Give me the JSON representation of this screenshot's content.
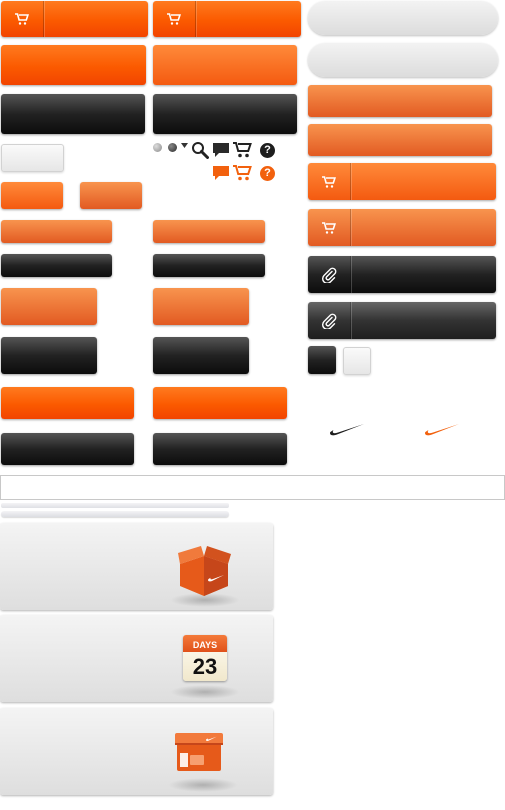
{
  "colors": {
    "orange": "#fb5a00",
    "orange_soft": "#ee6a2a",
    "dark": "#1a1a1a",
    "light": "#e8e8e8"
  },
  "icons": [
    "cart-icon",
    "paperclip-icon",
    "search-icon",
    "comment-icon",
    "help-icon",
    "swoosh-logo",
    "box-icon",
    "calendar-icon",
    "shoebox-icon"
  ],
  "calendar": {
    "label": "DAYS",
    "day": "23"
  },
  "help_glyph": "?"
}
